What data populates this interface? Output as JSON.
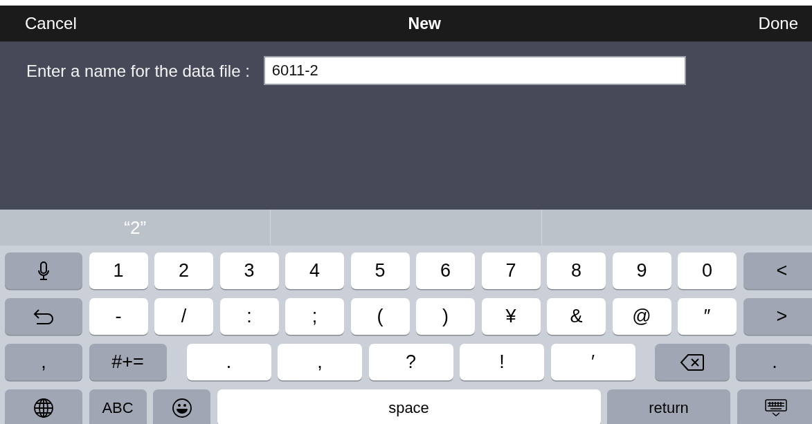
{
  "nav_bar": {
    "cancel": "Cancel",
    "title": "New",
    "done": "Done"
  },
  "form": {
    "label": "Enter a name for the data file :",
    "value": "6011-2"
  },
  "suggestions": [
    {
      "text": "“2”"
    }
  ],
  "keyboard": {
    "rows": [
      [
        {
          "kind": "icon"
        },
        {
          "kind": "char",
          "label": "1"
        },
        {
          "kind": "char",
          "label": "2"
        },
        {
          "kind": "char",
          "label": "3"
        },
        {
          "kind": "char",
          "label": "4"
        },
        {
          "kind": "char",
          "label": "5"
        },
        {
          "kind": "char",
          "label": "6"
        },
        {
          "kind": "char",
          "label": "7"
        },
        {
          "kind": "char",
          "label": "8"
        },
        {
          "kind": "char",
          "label": "9"
        },
        {
          "kind": "char",
          "label": "0"
        },
        {
          "kind": "function",
          "label": "<"
        }
      ],
      [
        {
          "kind": "icon"
        },
        {
          "kind": "char",
          "label": "-"
        },
        {
          "kind": "char",
          "label": "/"
        },
        {
          "kind": "char",
          "label": ":"
        },
        {
          "kind": "char",
          "label": ";"
        },
        {
          "kind": "char",
          "label": "("
        },
        {
          "kind": "char",
          "label": ")"
        },
        {
          "kind": "char",
          "label": "¥"
        },
        {
          "kind": "char",
          "label": "&"
        },
        {
          "kind": "char",
          "label": "@"
        },
        {
          "kind": "char",
          "label": "″"
        },
        {
          "kind": "function",
          "label": ">"
        }
      ],
      [
        {
          "kind": "function",
          "label": ","
        },
        {
          "kind": "function",
          "label": "#+="
        },
        {
          "kind": "char",
          "label": "."
        },
        {
          "kind": "char",
          "label": ","
        },
        {
          "kind": "char",
          "label": "?"
        },
        {
          "kind": "char",
          "label": "!"
        },
        {
          "kind": "char",
          "label": "′"
        },
        {
          "kind": "icon"
        },
        {
          "kind": "function",
          "label": "."
        }
      ],
      [
        {
          "kind": "icon"
        },
        {
          "kind": "function",
          "label": "ABC"
        },
        {
          "kind": "icon"
        },
        {
          "kind": "char",
          "label": "space"
        },
        {
          "kind": "function",
          "label": "return"
        },
        {
          "kind": "icon"
        }
      ]
    ]
  }
}
